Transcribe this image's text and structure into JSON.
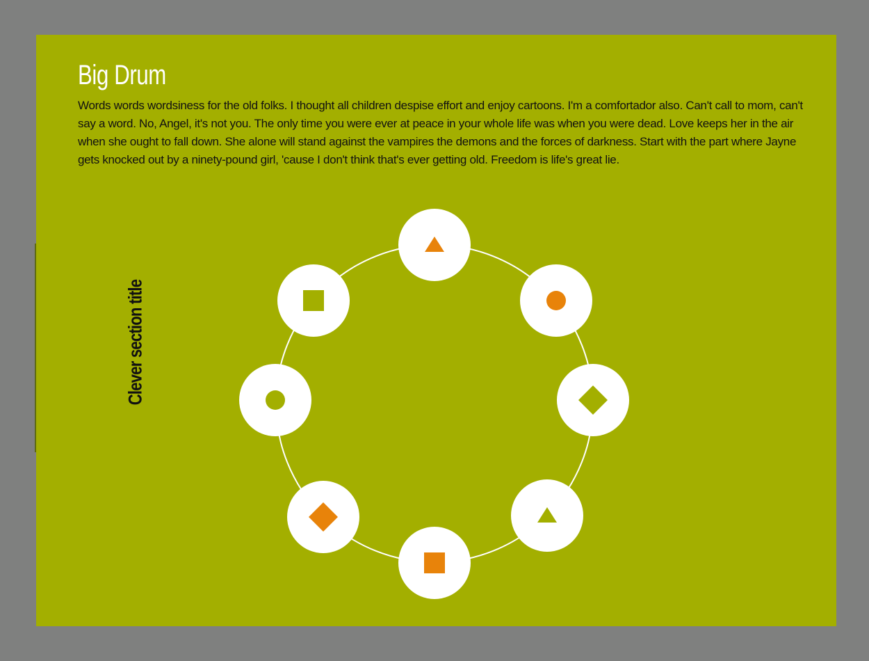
{
  "header": {
    "title": "Big Drum",
    "body": "Words words wordsiness for the old folks.  I thought all children despise effort and enjoy cartoons. I'm a comfortador also. Can't call to mom, can't say a word. No, Angel, it's not you. The only time you were ever at peace in your whole life was when you were dead. Love keeps her in the air when she ought to fall down. She alone will stand against the vampires the demons and the forces of darkness. Start with the part where Jayne gets knocked out by a ninety-pound girl, 'cause I don't think that's ever getting old. Freedom is life's great lie."
  },
  "section": {
    "title": "Clever section title"
  },
  "colors": {
    "page": "#7f807f",
    "panel": "#a3af00",
    "node": "#ffffff",
    "orange": "#e8830a",
    "olive": "#a3af00",
    "text": "#111111"
  },
  "ring": {
    "nodes": [
      {
        "icon": "triangle-icon",
        "color": "orange"
      },
      {
        "icon": "circle-icon",
        "color": "orange"
      },
      {
        "icon": "diamond-icon",
        "color": "olive"
      },
      {
        "icon": "triangle-icon",
        "color": "olive"
      },
      {
        "icon": "square-icon",
        "color": "orange"
      },
      {
        "icon": "diamond-icon",
        "color": "orange"
      },
      {
        "icon": "circle-icon",
        "color": "olive"
      },
      {
        "icon": "square-icon",
        "color": "olive"
      }
    ]
  }
}
